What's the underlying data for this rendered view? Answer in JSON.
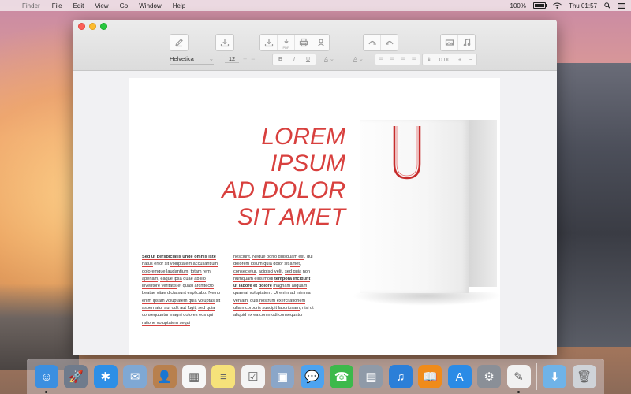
{
  "menubar": {
    "apple": "",
    "app_name": "Finder",
    "menus": [
      "File",
      "Edit",
      "View",
      "Go",
      "Window",
      "Help"
    ],
    "battery_percent": "100%",
    "clock": "Thu 01:57"
  },
  "toolbar": {
    "font_name": "Helvetica",
    "font_size": "12",
    "plus": "+",
    "minus": "−",
    "bold": "B",
    "italic": "I",
    "underline": "U",
    "text_color_glyph": "A",
    "highlight_glyph": "A",
    "line_spacing": "0.00",
    "pdf_label": "PDF"
  },
  "document": {
    "headline": [
      "LOREM",
      "IPSUM",
      "AD DOLOR",
      "SIT AMET"
    ],
    "col1": [
      {
        "t": "Sed ut perspiciatis unde omnis iste",
        "u": true,
        "b": true
      },
      {
        "t": " ",
        "u": false
      },
      {
        "t": "natus",
        "u": true
      },
      {
        "t": " error sit ",
        "u": false
      },
      {
        "t": "voluptatem accusantium doloremque laudantium",
        "u": true
      },
      {
        "t": ", ",
        "u": false
      },
      {
        "t": "totam",
        "u": true
      },
      {
        "t": " rem ",
        "u": false
      },
      {
        "t": "aperiam",
        "u": true
      },
      {
        "t": ", ",
        "u": false
      },
      {
        "t": "eaque ipsa",
        "u": true
      },
      {
        "t": " quae ",
        "u": false
      },
      {
        "t": "ab illo inventore veritatis",
        "u": true
      },
      {
        "t": " et quasi ",
        "u": false
      },
      {
        "t": "architecto beatae",
        "u": true
      },
      {
        "t": " vitae dicta ",
        "u": false
      },
      {
        "t": "sunt explicabo",
        "u": true
      },
      {
        "t": ". ",
        "u": false
      },
      {
        "t": "Nemo enim ipsam voluptatem quia voluptas",
        "u": true
      },
      {
        "t": " sit ",
        "u": false
      },
      {
        "t": "aspernatur aut odit aut fugit",
        "u": true
      },
      {
        "t": ", ",
        "u": false
      },
      {
        "t": "sed quia consequuntur magni dolores",
        "u": true
      },
      {
        "t": " ",
        "u": false
      },
      {
        "t": "eos",
        "u": true
      },
      {
        "t": " qui ",
        "u": false
      },
      {
        "t": "ratione voluptatem sequi",
        "u": true
      }
    ],
    "col2": [
      {
        "t": "nesciunt",
        "u": true
      },
      {
        "t": ". ",
        "u": false
      },
      {
        "t": "Neque porro quisquam est",
        "u": true
      },
      {
        "t": ", qui ",
        "u": false
      },
      {
        "t": "dolorem ipsum quia",
        "u": true
      },
      {
        "t": " dolor sit ",
        "u": false
      },
      {
        "t": "amet",
        "u": true
      },
      {
        "t": ", ",
        "u": false
      },
      {
        "t": "consectetur",
        "u": true
      },
      {
        "t": ", ",
        "u": false
      },
      {
        "t": "adipisci velit",
        "u": true
      },
      {
        "t": ", ",
        "u": false
      },
      {
        "t": "sed quia",
        "u": true
      },
      {
        "t": " non ",
        "u": false
      },
      {
        "t": "numquam eius modi",
        "u": true
      },
      {
        "t": " ",
        "u": false
      },
      {
        "t": "tempora incidunt ut labore",
        "u": true,
        "b": true
      },
      {
        "t": " et ",
        "u": false,
        "b": true
      },
      {
        "t": "dolore",
        "u": true,
        "b": true
      },
      {
        "t": " ",
        "u": false
      },
      {
        "t": "magnam aliquam quaerat voluptatem",
        "u": true
      },
      {
        "t": ". ",
        "u": false
      },
      {
        "t": "Ut enim",
        "u": true
      },
      {
        "t": " ad minima ",
        "u": false
      },
      {
        "t": "veniam",
        "u": true
      },
      {
        "t": ", quis ",
        "u": false
      },
      {
        "t": "nostrum exercitationem",
        "u": true
      },
      {
        "t": " ",
        "u": false
      },
      {
        "t": "ullam corporis",
        "u": true
      },
      {
        "t": " ",
        "u": false
      },
      {
        "t": "suscipit laboriosam",
        "u": true
      },
      {
        "t": ", nisi ut ",
        "u": false
      },
      {
        "t": "aliquid",
        "u": true
      },
      {
        "t": " ex ea ",
        "u": false
      },
      {
        "t": "commodi consequatur",
        "u": true
      }
    ]
  },
  "dock": {
    "items": [
      {
        "name": "finder-icon",
        "bg": "#3b8fe0",
        "glyph": "☺",
        "running": true
      },
      {
        "name": "launchpad-icon",
        "bg": "#6f7b8c",
        "glyph": "🚀",
        "running": false
      },
      {
        "name": "safari-icon",
        "bg": "#2d8fe6",
        "glyph": "✱",
        "running": false
      },
      {
        "name": "mail-icon",
        "bg": "#7fa8d4",
        "glyph": "✉",
        "running": false
      },
      {
        "name": "contacts-icon",
        "bg": "#b8804e",
        "glyph": "👤",
        "running": false
      },
      {
        "name": "calendar-icon",
        "bg": "#f7f7f7",
        "glyph": "▦",
        "running": false
      },
      {
        "name": "notes-icon",
        "bg": "#f6e27a",
        "glyph": "≡",
        "running": false
      },
      {
        "name": "reminders-icon",
        "bg": "#f4f4f4",
        "glyph": "☑",
        "running": false
      },
      {
        "name": "preview-icon",
        "bg": "#8aa6c8",
        "glyph": "▣",
        "running": false
      },
      {
        "name": "messages-icon",
        "bg": "#4ca3f0",
        "glyph": "💬",
        "running": false
      },
      {
        "name": "facetime-icon",
        "bg": "#3cb94b",
        "glyph": "☎",
        "running": false
      },
      {
        "name": "photos-icon",
        "bg": "#8f9aa8",
        "glyph": "▤",
        "running": false
      },
      {
        "name": "itunes-icon",
        "bg": "#2b7fd8",
        "glyph": "♫",
        "running": false
      },
      {
        "name": "ibooks-icon",
        "bg": "#f08b1a",
        "glyph": "📖",
        "running": false
      },
      {
        "name": "app-store-icon",
        "bg": "#2a8be6",
        "glyph": "A",
        "running": false
      },
      {
        "name": "system-preferences-icon",
        "bg": "#8a8f97",
        "glyph": "⚙",
        "running": false
      },
      {
        "name": "textedit-icon",
        "bg": "#f1f1f1",
        "glyph": "✎",
        "running": true
      },
      {
        "name": "downloads-folder-icon",
        "bg": "#6fb3e8",
        "glyph": "⬇",
        "running": false
      },
      {
        "name": "trash-icon",
        "bg": "#cfd3d8",
        "glyph": "🗑",
        "running": false
      }
    ]
  }
}
